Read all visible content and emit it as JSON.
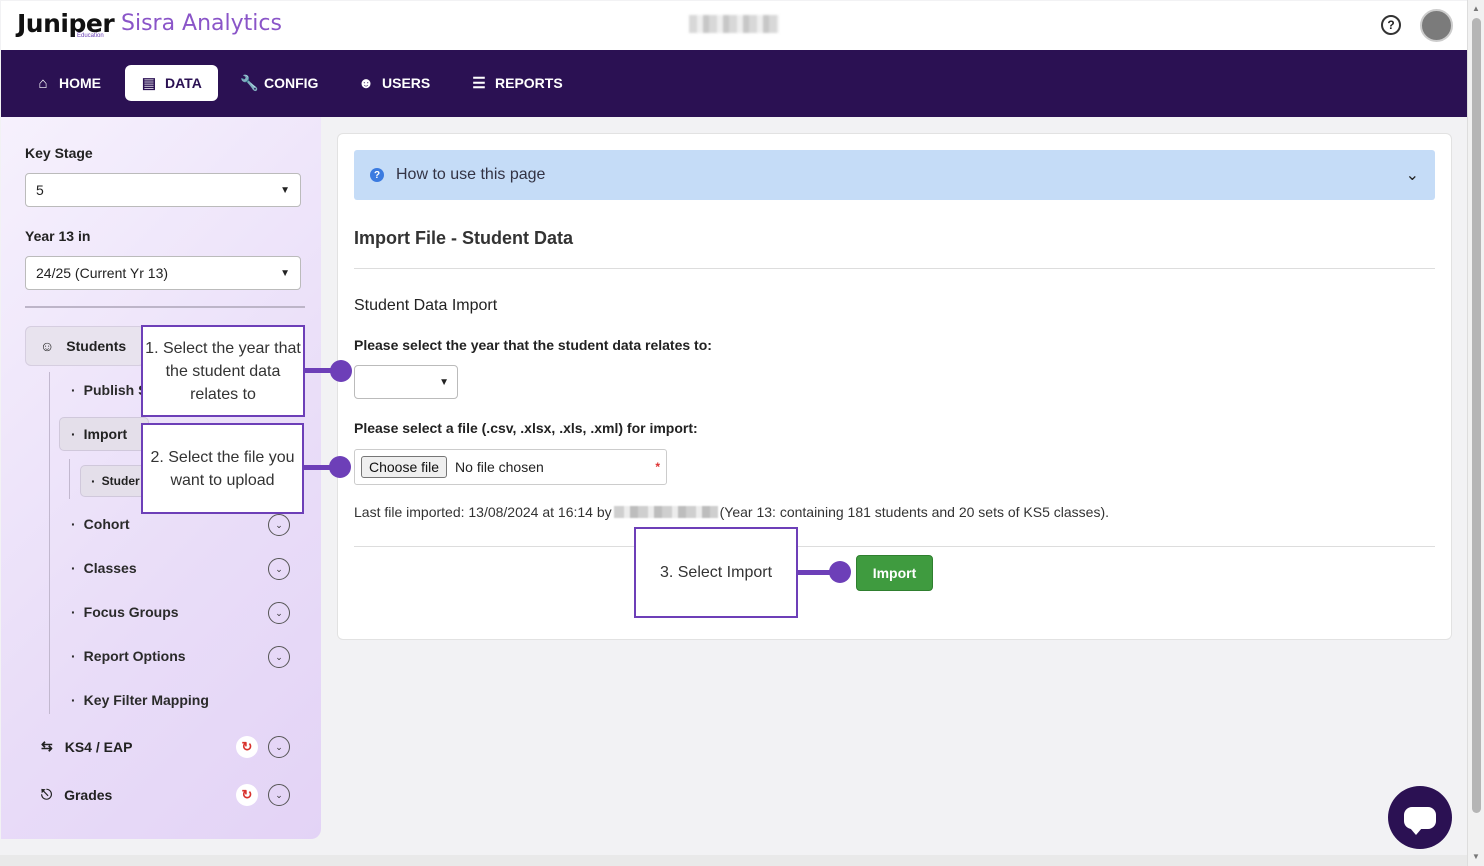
{
  "header": {
    "logo_main": "Juniper",
    "logo_sub": "Education",
    "product_name": "Sisra Analytics",
    "help_icon": "?"
  },
  "nav": {
    "items": [
      {
        "label": "HOME",
        "icon": "home-icon",
        "active": false
      },
      {
        "label": "DATA",
        "icon": "database-icon",
        "active": true
      },
      {
        "label": "CONFIG",
        "icon": "wrench-icon",
        "active": false
      },
      {
        "label": "USERS",
        "icon": "users-icon",
        "active": false
      },
      {
        "label": "REPORTS",
        "icon": "chart-icon",
        "active": false
      }
    ]
  },
  "sidebar": {
    "key_stage_label": "Key Stage",
    "key_stage_value": "5",
    "year_label": "Year 13 in",
    "year_value": "24/25 (Current Yr 13)",
    "students_label": "Students",
    "publish_label": "Publish S",
    "import_label": "Import",
    "student_sub_label": "Studer",
    "items": [
      {
        "label": "Cohort"
      },
      {
        "label": "Classes"
      },
      {
        "label": "Focus Groups"
      },
      {
        "label": "Report Options"
      },
      {
        "label": "Key Filter Mapping"
      }
    ],
    "groups": [
      {
        "label": "KS4 / EAP"
      },
      {
        "label": "Grades"
      }
    ]
  },
  "callouts": {
    "step1": "1. Select the year that the student data relates to",
    "step2": "2. Select the file you want to upload",
    "step3": "3. Select Import"
  },
  "main": {
    "howto_label": "How to use this page",
    "title": "Import File - Student Data",
    "section_title": "Student Data Import",
    "year_question": "Please select the year that the student data relates to:",
    "file_question": "Please select a file (.csv, .xlsx, .xls, .xml) for import:",
    "choose_file_label": "Choose file",
    "no_file_label": "No file chosen",
    "required_marker": "*",
    "last_import_prefix": "Last file imported: 13/08/2024 at 16:14 by",
    "last_import_suffix": "(Year 13: containing 181 students and 20 sets of KS5 classes).",
    "import_button": "Import"
  },
  "colors": {
    "nav_bg": "#2b1153",
    "accent_purple": "#6d3fb8",
    "import_green": "#3f9b3f",
    "info_blue_bg": "#c5dcf7"
  }
}
